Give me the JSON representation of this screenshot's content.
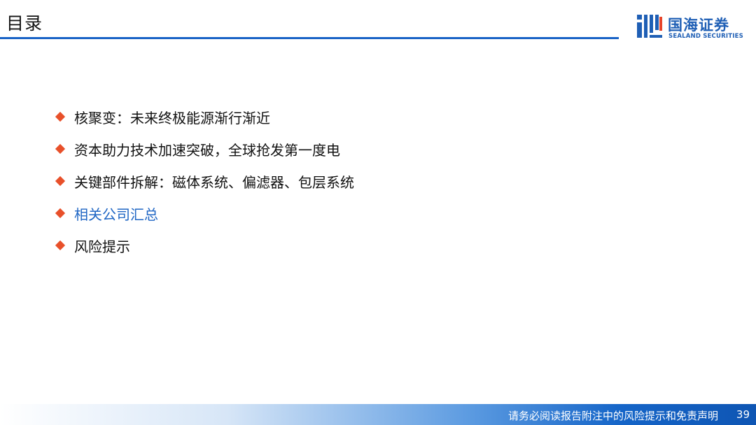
{
  "header": {
    "title": "目录"
  },
  "logo": {
    "name_cn": "国海证券",
    "name_en": "SEALAND SECURITIES",
    "color": "#1f5fb5"
  },
  "toc": {
    "bullet_color": "#e8502a",
    "active_color": "#1f66c4",
    "items": [
      {
        "label": "核聚变：未来终极能源渐行渐近",
        "active": false
      },
      {
        "label": "资本助力技术加速突破，全球抢发第一度电",
        "active": false
      },
      {
        "label": "关键部件拆解：磁体系统、偏滤器、包层系统",
        "active": false
      },
      {
        "label": "相关公司汇总",
        "active": true
      },
      {
        "label": "风险提示",
        "active": false
      }
    ]
  },
  "footer": {
    "disclaimer": "请务必阅读报告附注中的风险提示和免责声明",
    "page_number": "39"
  }
}
